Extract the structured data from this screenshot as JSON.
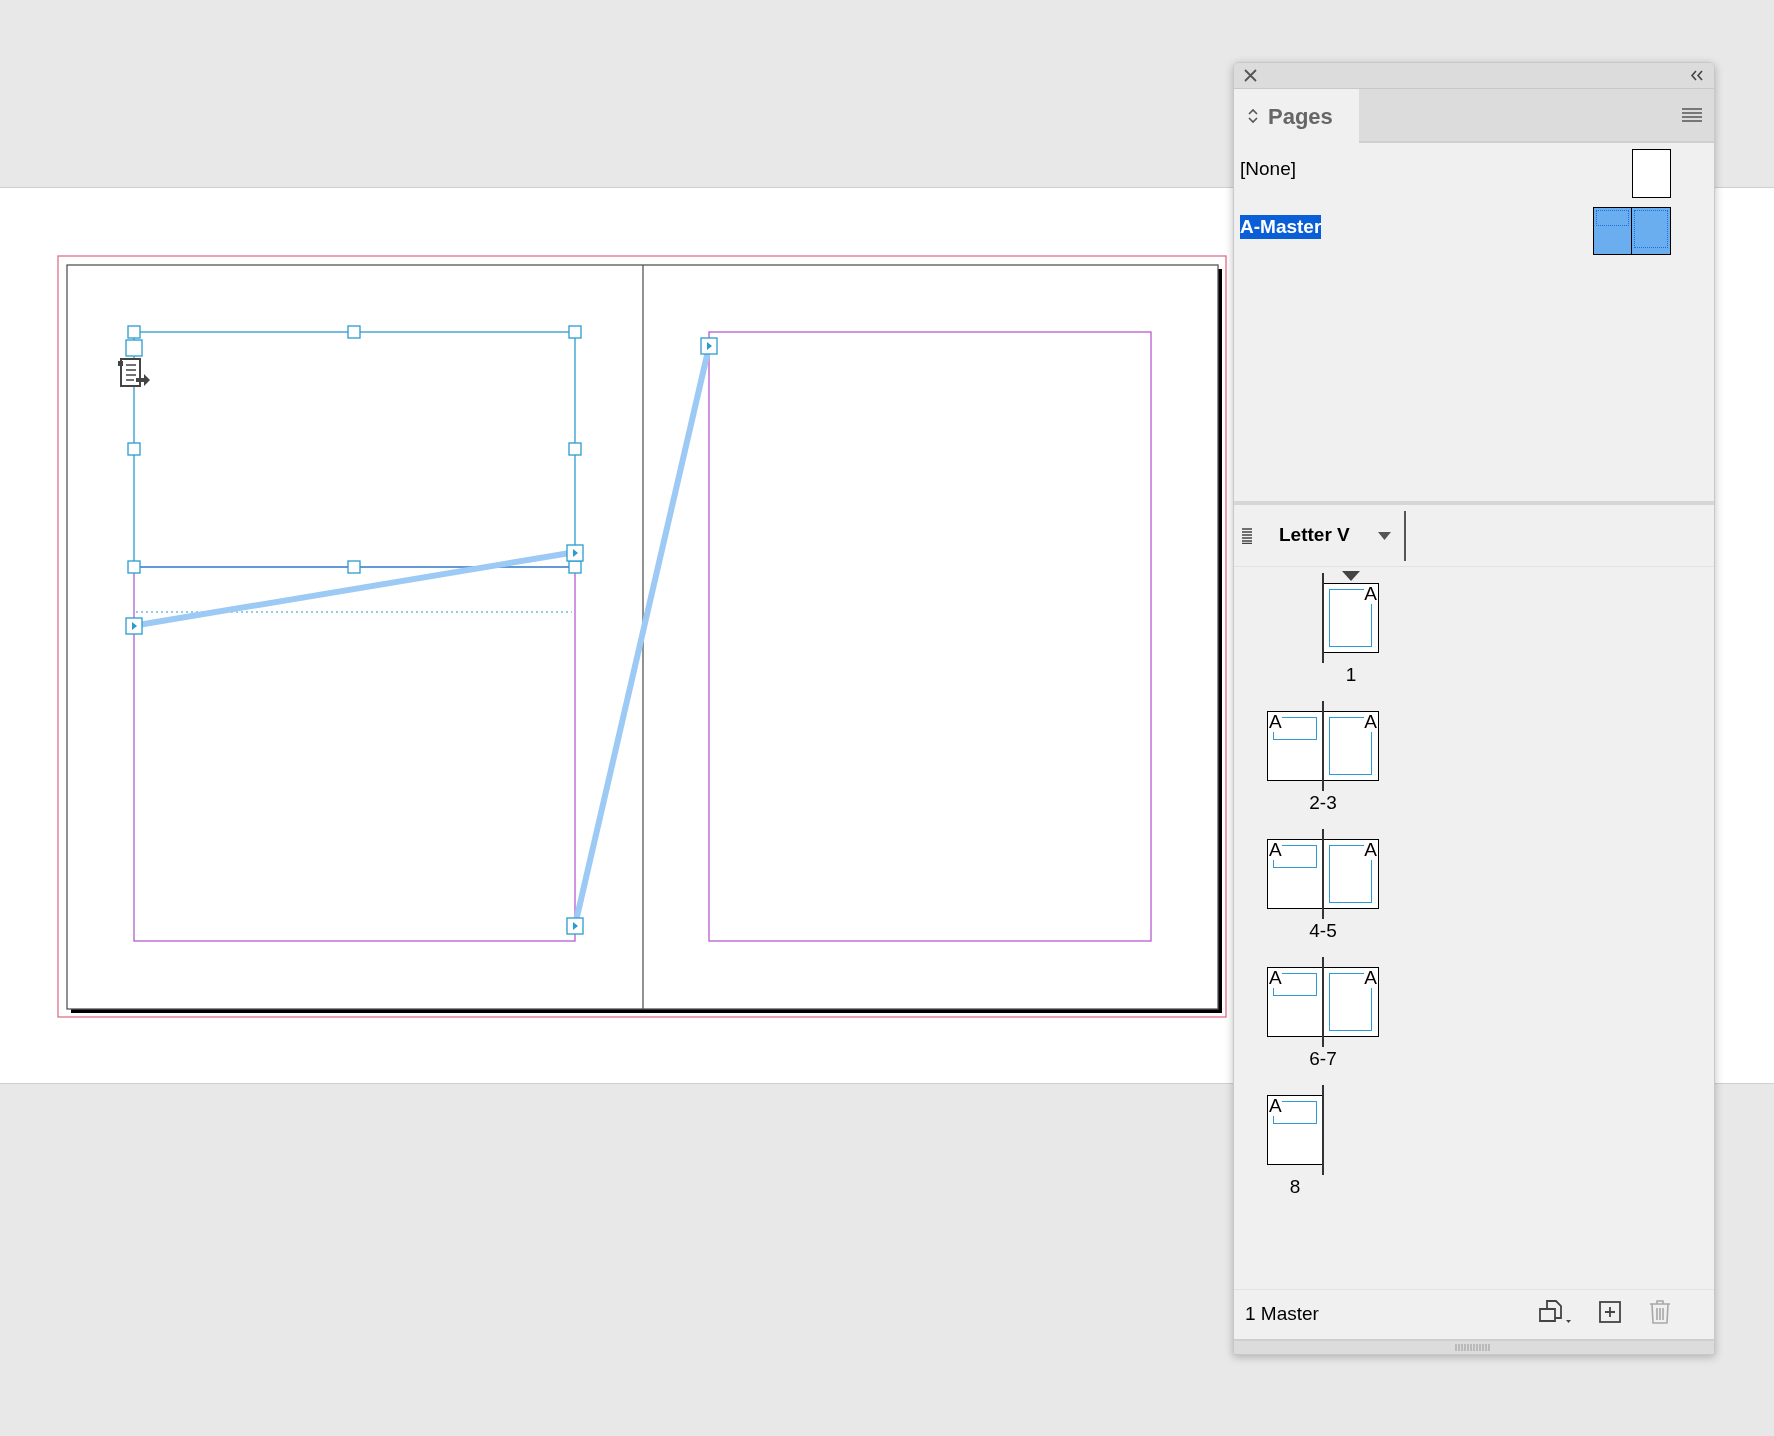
{
  "panel": {
    "tab": {
      "label": "Pages",
      "selected": true
    },
    "masters": [
      {
        "label": "[None]",
        "kind": "single",
        "selected": false
      },
      {
        "label": "A-Master",
        "kind": "spread",
        "selected": true
      }
    ],
    "page_size": "Letter V",
    "spreads": [
      {
        "label": "1",
        "current": true,
        "right": "A"
      },
      {
        "label": "2-3",
        "current": false,
        "left": "A",
        "right": "A"
      },
      {
        "label": "4-5",
        "current": false,
        "left": "A",
        "right": "A"
      },
      {
        "label": "6-7",
        "current": false,
        "left": "A",
        "right": "A"
      },
      {
        "label": "8",
        "current": false,
        "left": "A"
      }
    ],
    "footer": {
      "status": "1 Master",
      "buttons": [
        {
          "kind": "page-size",
          "disabled": false
        },
        {
          "kind": "new-page",
          "disabled": false
        },
        {
          "kind": "delete",
          "disabled": true
        }
      ]
    }
  }
}
